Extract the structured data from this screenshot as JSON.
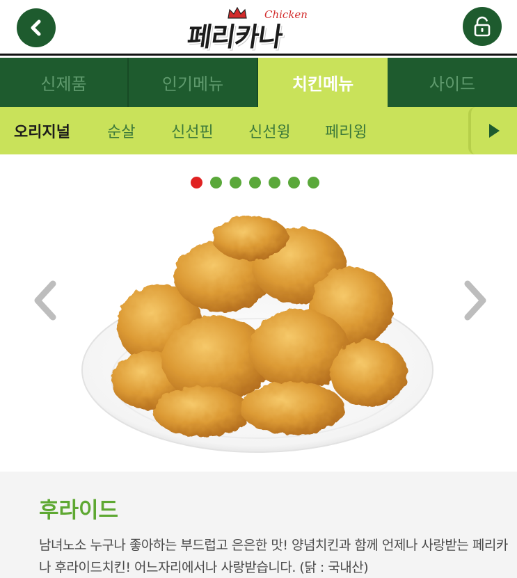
{
  "header": {
    "logo_main": "페리카나",
    "logo_sub": "Chicken"
  },
  "categories": [
    {
      "label": "신제품",
      "active": false
    },
    {
      "label": "인기메뉴",
      "active": false
    },
    {
      "label": "치킨메뉴",
      "active": true
    },
    {
      "label": "사이드",
      "active": false
    }
  ],
  "subcategories": [
    {
      "label": "오리지널",
      "active": true
    },
    {
      "label": "순살",
      "active": false
    },
    {
      "label": "신선핀",
      "active": false
    },
    {
      "label": "신선윙",
      "active": false
    },
    {
      "label": "페리윙",
      "active": false
    }
  ],
  "slider": {
    "total_slides": 7,
    "current_slide": 1
  },
  "product": {
    "name": "후라이드",
    "description": "남녀노소 누구나 좋아하는 부드럽고 은은한 맛! 양념치킨과 함께 언제나 사랑받는 페리카나 후라이드치킨! 어느자리에서나 사랑받습니다. (닭 : 국내산)"
  },
  "colors": {
    "brand_green": "#1e5b2e",
    "accent_lime": "#c9e25a",
    "title_green": "#5ea832",
    "active_dot": "#e02222"
  }
}
